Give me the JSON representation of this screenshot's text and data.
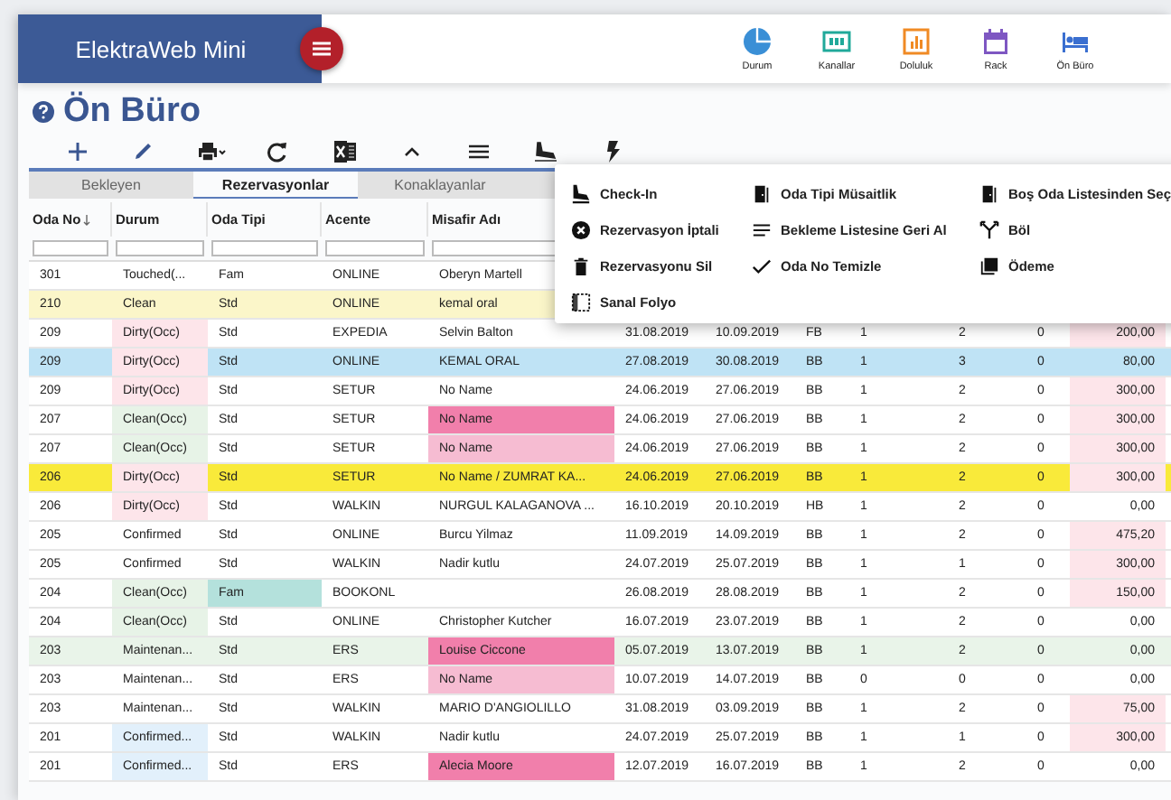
{
  "app": {
    "title": "ElektraWeb Mini"
  },
  "nav": [
    {
      "label": "Durum"
    },
    {
      "label": "Kanallar"
    },
    {
      "label": "Doluluk"
    },
    {
      "label": "Rack"
    },
    {
      "label": "Ön Büro"
    }
  ],
  "page": {
    "title": "Ön Büro"
  },
  "tabs": [
    {
      "label": "Bekleyen",
      "selected": false
    },
    {
      "label": "Rezervasyonlar",
      "selected": true
    },
    {
      "label": "Konaklayanlar",
      "selected": false
    }
  ],
  "table": {
    "columns": [
      {
        "label": "Oda No",
        "sorted": true
      },
      {
        "label": "Durum",
        "sorted": false
      },
      {
        "label": "Oda Tipi",
        "sorted": false
      },
      {
        "label": "Acente",
        "sorted": false
      },
      {
        "label": "Misafir Adı",
        "sorted": false
      }
    ],
    "rows": [
      {
        "cells": [
          {
            "text": "301"
          },
          {
            "text": "Touched(..."
          },
          {
            "text": "Fam"
          },
          {
            "text": "ONLINE"
          },
          {
            "text": "Oberyn Martell"
          }
        ]
      },
      {
        "color": "#fbf6c9",
        "cells": [
          {
            "text": "210"
          },
          {
            "text": "Clean"
          },
          {
            "text": "Std"
          },
          {
            "text": "ONLINE"
          },
          {
            "text": "kemal oral"
          }
        ]
      },
      {
        "cells": [
          {
            "text": "209"
          },
          {
            "text": "Dirty(Occ)",
            "color": "#fde5ea"
          },
          {
            "text": "Std"
          },
          {
            "text": "EXPEDIA"
          },
          {
            "text": "Selvin Balton"
          },
          {
            "text": "31.08.2019"
          },
          {
            "text": "10.09.2019"
          },
          {
            "text": "FB"
          },
          {
            "text": "1"
          },
          {
            "text": "2"
          },
          {
            "text": "0"
          },
          {
            "text": "200,00",
            "color": "#fde5ea"
          }
        ]
      },
      {
        "color": "#bfe3f5",
        "cells": [
          {
            "text": "209"
          },
          {
            "text": "Dirty(Occ)",
            "color": "#fde5ea"
          },
          {
            "text": "Std"
          },
          {
            "text": "ONLINE"
          },
          {
            "text": "KEMAL ORAL"
          },
          {
            "text": "27.08.2019"
          },
          {
            "text": "30.08.2019"
          },
          {
            "text": "BB"
          },
          {
            "text": "1"
          },
          {
            "text": "3"
          },
          {
            "text": "0"
          },
          {
            "text": "80,00"
          }
        ]
      },
      {
        "cells": [
          {
            "text": "209"
          },
          {
            "text": "Dirty(Occ)",
            "color": "#fde5ea"
          },
          {
            "text": "Std"
          },
          {
            "text": "SETUR"
          },
          {
            "text": "No Name"
          },
          {
            "text": "24.06.2019"
          },
          {
            "text": "27.06.2019"
          },
          {
            "text": "BB"
          },
          {
            "text": "1"
          },
          {
            "text": "2"
          },
          {
            "text": "0"
          },
          {
            "text": "300,00",
            "color": "#fde5ea"
          }
        ]
      },
      {
        "cells": [
          {
            "text": "207"
          },
          {
            "text": "Clean(Occ)",
            "color": "#e7f3e7"
          },
          {
            "text": "Std"
          },
          {
            "text": "SETUR"
          },
          {
            "text": "No Name",
            "color": "#f17fab"
          },
          {
            "text": "24.06.2019"
          },
          {
            "text": "27.06.2019"
          },
          {
            "text": "BB"
          },
          {
            "text": "1"
          },
          {
            "text": "2"
          },
          {
            "text": "0"
          },
          {
            "text": "300,00",
            "color": "#fde5ea"
          }
        ]
      },
      {
        "cells": [
          {
            "text": "207"
          },
          {
            "text": "Clean(Occ)",
            "color": "#e7f3e7"
          },
          {
            "text": "Std"
          },
          {
            "text": "SETUR"
          },
          {
            "text": "No Name",
            "color": "#f6bcd2"
          },
          {
            "text": "24.06.2019"
          },
          {
            "text": "27.06.2019"
          },
          {
            "text": "BB"
          },
          {
            "text": "1"
          },
          {
            "text": "2"
          },
          {
            "text": "0"
          },
          {
            "text": "300,00",
            "color": "#fde5ea"
          }
        ]
      },
      {
        "color": "#f9ea3a",
        "cells": [
          {
            "text": "206"
          },
          {
            "text": "Dirty(Occ)",
            "color": "#fde5ea"
          },
          {
            "text": "Std"
          },
          {
            "text": "SETUR"
          },
          {
            "text": "No Name / ZUMRAT KA..."
          },
          {
            "text": "24.06.2019"
          },
          {
            "text": "27.06.2019"
          },
          {
            "text": "BB"
          },
          {
            "text": "1"
          },
          {
            "text": "2"
          },
          {
            "text": "0"
          },
          {
            "text": "300,00",
            "color": "#fde5ea"
          }
        ]
      },
      {
        "cells": [
          {
            "text": "206"
          },
          {
            "text": "Dirty(Occ)",
            "color": "#fde5ea"
          },
          {
            "text": "Std"
          },
          {
            "text": "WALKIN"
          },
          {
            "text": "NURGUL KALAGANOVA ..."
          },
          {
            "text": "16.10.2019"
          },
          {
            "text": "20.10.2019"
          },
          {
            "text": "HB"
          },
          {
            "text": "1"
          },
          {
            "text": "2"
          },
          {
            "text": "0"
          },
          {
            "text": "0,00"
          }
        ]
      },
      {
        "cells": [
          {
            "text": "205"
          },
          {
            "text": "Confirmed"
          },
          {
            "text": "Std"
          },
          {
            "text": "ONLINE"
          },
          {
            "text": "Burcu Yilmaz"
          },
          {
            "text": "11.09.2019"
          },
          {
            "text": "14.09.2019"
          },
          {
            "text": "BB"
          },
          {
            "text": "1"
          },
          {
            "text": "2"
          },
          {
            "text": "0"
          },
          {
            "text": "475,20",
            "color": "#fde5ea"
          }
        ]
      },
      {
        "cells": [
          {
            "text": "205"
          },
          {
            "text": "Confirmed"
          },
          {
            "text": "Std"
          },
          {
            "text": "WALKIN"
          },
          {
            "text": "Nadir kutlu"
          },
          {
            "text": "24.07.2019"
          },
          {
            "text": "25.07.2019"
          },
          {
            "text": "BB"
          },
          {
            "text": "1"
          },
          {
            "text": "1"
          },
          {
            "text": "0"
          },
          {
            "text": "300,00",
            "color": "#fde5ea"
          }
        ]
      },
      {
        "cells": [
          {
            "text": "204"
          },
          {
            "text": "Clean(Occ)",
            "color": "#e7f3e7"
          },
          {
            "text": "Fam",
            "color": "#b4e1dc"
          },
          {
            "text": "BOOKONL"
          },
          {},
          {
            "text": "26.08.2019"
          },
          {
            "text": "28.08.2019"
          },
          {
            "text": "BB"
          },
          {
            "text": "1"
          },
          {
            "text": "2"
          },
          {
            "text": "0"
          },
          {
            "text": "150,00",
            "color": "#fde5ea"
          }
        ]
      },
      {
        "cells": [
          {
            "text": "204"
          },
          {
            "text": "Clean(Occ)",
            "color": "#e7f3e7"
          },
          {
            "text": "Std"
          },
          {
            "text": "ONLINE"
          },
          {
            "text": "Christopher Kutcher"
          },
          {
            "text": "16.07.2019"
          },
          {
            "text": "23.07.2019"
          },
          {
            "text": "BB"
          },
          {
            "text": "1"
          },
          {
            "text": "2"
          },
          {
            "text": "0"
          },
          {
            "text": "0,00"
          }
        ]
      },
      {
        "color": "#e9f4e9",
        "cells": [
          {
            "text": "203"
          },
          {
            "text": "Maintenan..."
          },
          {
            "text": "Std"
          },
          {
            "text": "ERS"
          },
          {
            "text": "Louise Ciccone",
            "color": "#f17fab"
          },
          {
            "text": "05.07.2019"
          },
          {
            "text": "13.07.2019"
          },
          {
            "text": "BB"
          },
          {
            "text": "1"
          },
          {
            "text": "2"
          },
          {
            "text": "0"
          },
          {
            "text": "0,00"
          }
        ]
      },
      {
        "cells": [
          {
            "text": "203"
          },
          {
            "text": "Maintenan..."
          },
          {
            "text": "Std"
          },
          {
            "text": "ERS"
          },
          {
            "text": "No Name",
            "color": "#f6bcd2"
          },
          {
            "text": "10.07.2019"
          },
          {
            "text": "14.07.2019"
          },
          {
            "text": "BB"
          },
          {
            "text": "0"
          },
          {
            "text": "0"
          },
          {
            "text": "0"
          },
          {
            "text": "0,00"
          }
        ]
      },
      {
        "cells": [
          {
            "text": "203"
          },
          {
            "text": "Maintenan..."
          },
          {
            "text": "Std"
          },
          {
            "text": "WALKIN"
          },
          {
            "text": "MARIO D'ANGIOLILLO"
          },
          {
            "text": "31.08.2019"
          },
          {
            "text": "03.09.2019"
          },
          {
            "text": "BB"
          },
          {
            "text": "1"
          },
          {
            "text": "2"
          },
          {
            "text": "0"
          },
          {
            "text": "75,00",
            "color": "#fde5ea"
          }
        ]
      },
      {
        "cells": [
          {
            "text": "201"
          },
          {
            "text": "Confirmed...",
            "color": "#e2f0fb"
          },
          {
            "text": "Std"
          },
          {
            "text": "WALKIN"
          },
          {
            "text": "Nadir kutlu"
          },
          {
            "text": "24.07.2019"
          },
          {
            "text": "25.07.2019"
          },
          {
            "text": "BB"
          },
          {
            "text": "1"
          },
          {
            "text": "1"
          },
          {
            "text": "0"
          },
          {
            "text": "300,00",
            "color": "#fde5ea"
          }
        ]
      },
      {
        "cells": [
          {
            "text": "201"
          },
          {
            "text": "Confirmed...",
            "color": "#e2f0fb"
          },
          {
            "text": "Std"
          },
          {
            "text": "ERS"
          },
          {
            "text": "Alecia Moore",
            "color": "#f17fab"
          },
          {
            "text": "12.07.2019"
          },
          {
            "text": "16.07.2019"
          },
          {
            "text": "BB"
          },
          {
            "text": "1"
          },
          {
            "text": "2"
          },
          {
            "text": "0"
          },
          {
            "text": "0,00"
          }
        ]
      }
    ]
  },
  "menu": {
    "items": [
      {
        "label": "Check-In"
      },
      {
        "label": "Oda Tipi Müsaitlik"
      },
      {
        "label": "Boş Oda Listesinden Seç"
      },
      {
        "label": "Rezervasyon İptali"
      },
      {
        "label": "Bekleme Listesine Geri Al"
      },
      {
        "label": "Böl"
      },
      {
        "label": "Rezervasyonu Sil"
      },
      {
        "label": "Oda No Temizle"
      },
      {
        "label": "Ödeme"
      },
      {
        "label": "Sanal Folyo"
      }
    ]
  }
}
